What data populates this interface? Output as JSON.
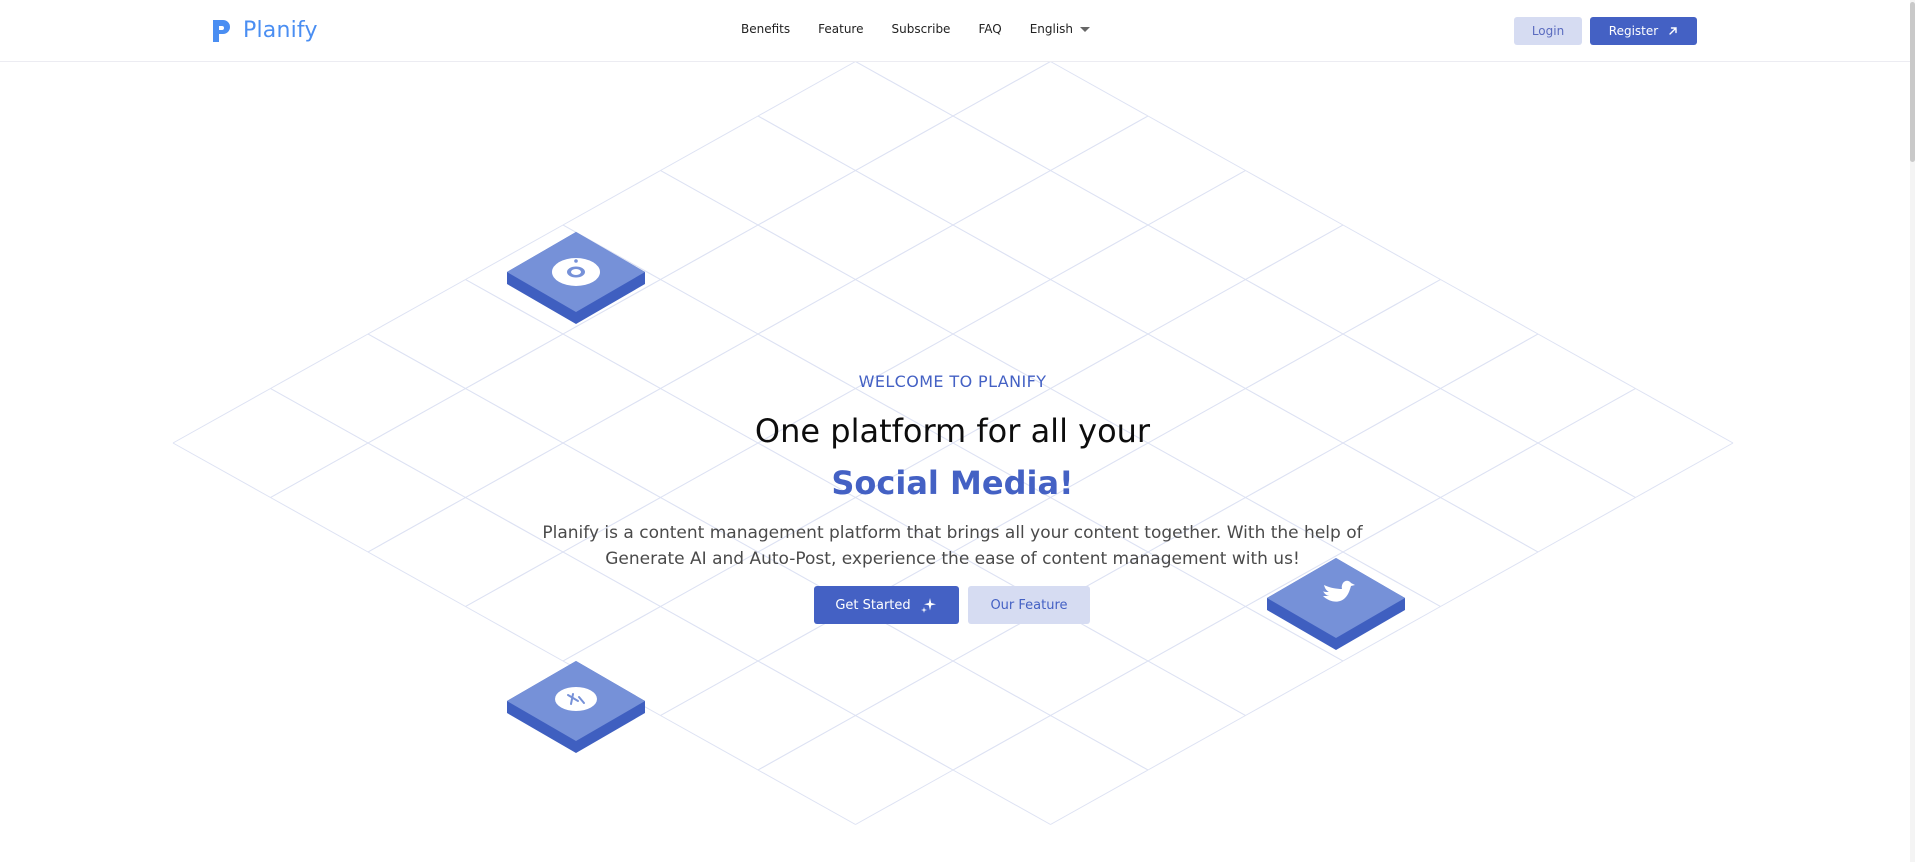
{
  "brand": {
    "name": "Planify",
    "accent": "#4461c4",
    "logo_color": "#4a8ef2"
  },
  "nav": {
    "links": [
      "Benefits",
      "Feature",
      "Subscribe",
      "FAQ"
    ],
    "language": "English",
    "login_label": "Login",
    "register_label": "Register"
  },
  "hero": {
    "eyebrow": "WELCOME TO PLANIFY",
    "headline_line1": "One platform for all your",
    "headline_line2": "Social Media!",
    "description": "Planify is a content management platform that brings all your content together. With the help of Generate AI and Auto-Post, experience the ease of content management with us!",
    "primary_cta": "Get Started",
    "secondary_cta": "Our Feature"
  },
  "tiles": [
    {
      "name": "instagram-tile",
      "icon": "instagram-icon"
    },
    {
      "name": "twitter-tile",
      "icon": "twitter-bird-icon"
    },
    {
      "name": "whatsapp-tile",
      "icon": "whatsapp-icon"
    }
  ]
}
